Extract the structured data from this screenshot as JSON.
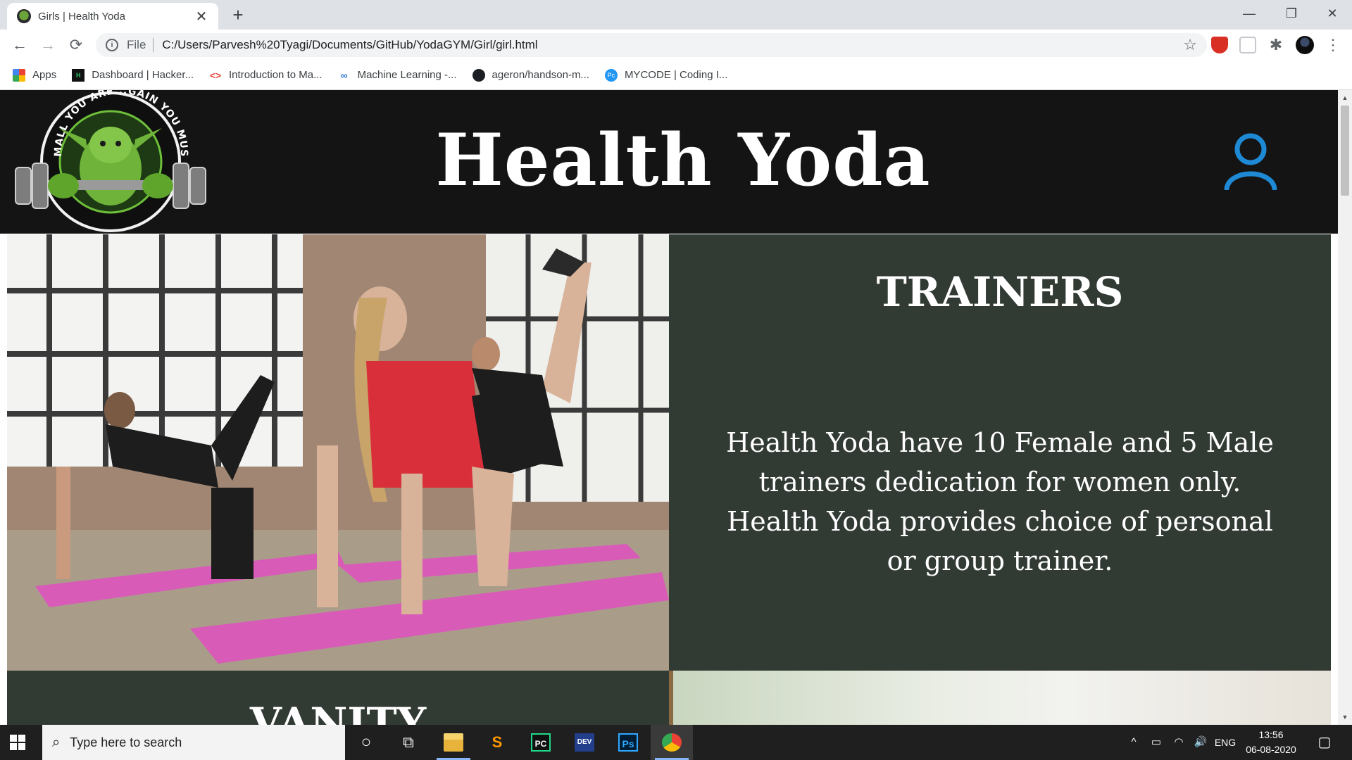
{
  "browser": {
    "tab_title": "Girls | Health Yoda",
    "tab_close": "✕",
    "new_tab": "+",
    "window_controls": {
      "minimize": "—",
      "restore": "❐",
      "close": "✕"
    },
    "nav": {
      "back": "←",
      "forward": "→",
      "reload": "⟳"
    },
    "info_glyph": "i",
    "scheme": "File",
    "url": "C:/Users/Parvesh%20Tyagi/Documents/GitHub/YodaGYM/Girl/girl.html",
    "star": "☆",
    "puzzle": "✱",
    "menu": "⋮"
  },
  "bookmarks": [
    {
      "label": "Apps",
      "icon": "apps-icon",
      "glyph": ""
    },
    {
      "label": "Dashboard | Hacker...",
      "icon": "hackerrank-icon",
      "glyph": "H"
    },
    {
      "label": "Introduction to Ma...",
      "icon": "code-icon",
      "glyph": "<>"
    },
    {
      "label": "Machine Learning -...",
      "icon": "coursera-icon",
      "glyph": "∞"
    },
    {
      "label": "ageron/handson-m...",
      "icon": "github-icon",
      "glyph": ""
    },
    {
      "label": "MYCODE | Coding I...",
      "icon": "mycode-icon",
      "glyph": "Pc"
    }
  ],
  "site": {
    "title": "Health Yoda",
    "logo_text": "SMALL YOU ARE...GAIN YOU MUST",
    "trainers": {
      "heading": "TRAINERS",
      "text": "Health Yoda have 10 Female and 5 Male trainers dedication for women only. Health Yoda provides choice of personal or group trainer."
    },
    "vanity_heading": "VANITY"
  },
  "scrollbar": {
    "up": "▲",
    "down": "▼"
  },
  "taskbar": {
    "search_placeholder": "Type here to search",
    "search_glyph": "⌕",
    "apps": [
      {
        "name": "cortana-icon",
        "glyph": "○"
      },
      {
        "name": "task-view-icon",
        "glyph": "⧉"
      },
      {
        "name": "file-explorer-icon",
        "glyph": ""
      },
      {
        "name": "sublime-text-icon",
        "glyph": "S"
      },
      {
        "name": "pycharm-icon",
        "glyph": "PC"
      },
      {
        "name": "devcpp-icon",
        "glyph": "DEV"
      },
      {
        "name": "photoshop-icon",
        "glyph": "Ps"
      },
      {
        "name": "chrome-icon",
        "glyph": ""
      }
    ],
    "tray": {
      "chevron": "^",
      "battery": "▭",
      "wifi": "◠",
      "volume": "🔊",
      "language": "ENG",
      "notifications": "▢"
    },
    "time": "13:56",
    "date": "06-08-2020"
  },
  "colors": {
    "header_bg": "#141414",
    "panel_bg": "#323a34",
    "user_icon": "#1e8ad6",
    "mat_pink": "#d95bb8"
  }
}
